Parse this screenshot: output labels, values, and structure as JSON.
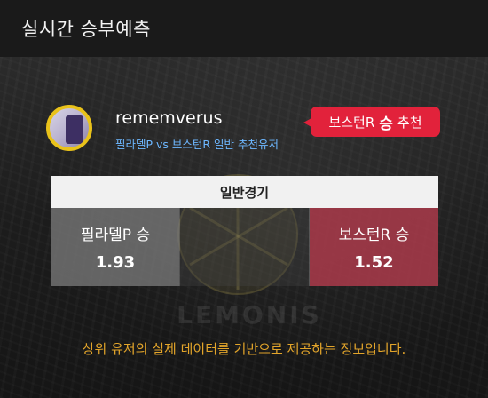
{
  "header": {
    "title": "실시간 승부예측"
  },
  "watermark": {
    "text": "LEMONIS"
  },
  "user": {
    "name": "rememverus",
    "match_description": "필라델P vs 보스턴R 일반 추천유저"
  },
  "recommendation": {
    "team": "보스턴R",
    "result": "승",
    "suffix": "추천",
    "color": "#e2223b"
  },
  "game": {
    "type_label": "일반경기",
    "home": {
      "label": "필라델P 승",
      "odds": "1.93"
    },
    "away": {
      "label": "보스턴R 승",
      "odds": "1.52"
    }
  },
  "footer": {
    "note": "상위 유저의 실제 데이터를 기반으로 제공하는 정보입니다."
  },
  "colors": {
    "accent_yellow": "#e9c21a",
    "link_blue": "#6db7ff",
    "note_orange": "#e3a52a",
    "away_red": "#aa3a4b"
  }
}
